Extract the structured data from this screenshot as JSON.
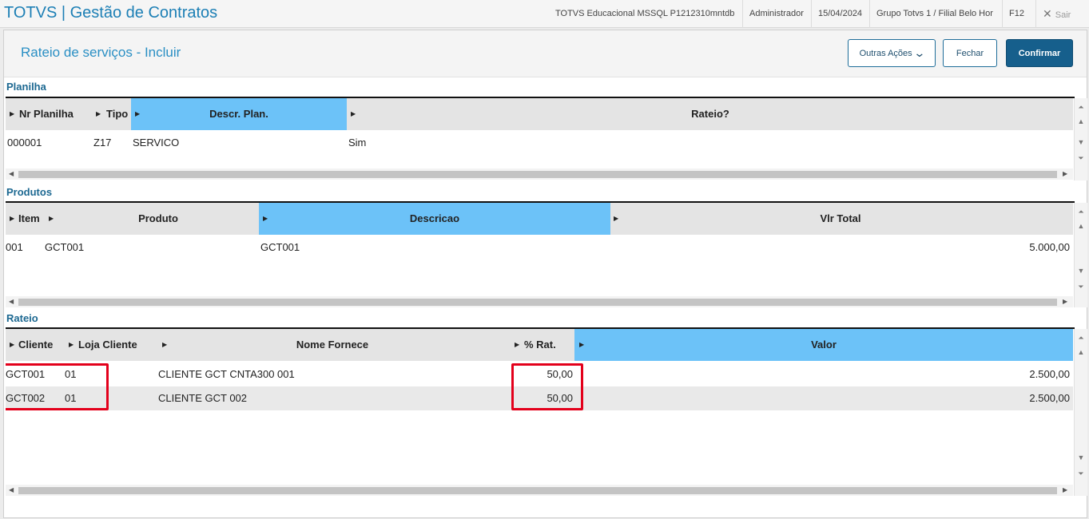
{
  "app": {
    "title": "TOTVS | Gestão de Contratos",
    "environment": "TOTVS Educacional MSSQL P1212310mntdb",
    "user": "Administrador",
    "date": "15/04/2024",
    "branch": "Grupo Totvs 1 / Filial Belo Hor",
    "help_key": "F12",
    "exit_label": "Sair"
  },
  "dialog": {
    "title": "Rateio de serviços - Incluir",
    "buttons": {
      "other_actions": "Outras Ações",
      "close": "Fechar",
      "confirm": "Confirmar"
    }
  },
  "planilha": {
    "title": "Planilha",
    "columns": [
      "Nr Planilha",
      "Tipo",
      "Descr. Plan.",
      "Rateio?"
    ],
    "rows": [
      {
        "nr": "000001",
        "tipo": "Z17",
        "descr": "SERVICO",
        "rateio": "Sim"
      }
    ]
  },
  "produtos": {
    "title": "Produtos",
    "columns": [
      "Item",
      "Produto",
      "Descricao",
      "Vlr Total"
    ],
    "rows": [
      {
        "item": "001",
        "produto": "GCT001",
        "descricao": "GCT001",
        "vlr_total": "5.000,00"
      }
    ]
  },
  "rateio": {
    "title": "Rateio",
    "columns": [
      "Cliente",
      "Loja Cliente",
      "Nome Fornece",
      "% Rat.",
      "Valor"
    ],
    "rows": [
      {
        "cliente": "GCT001",
        "loja": "01",
        "nome": "CLIENTE GCT CNTA300 001",
        "pct": "50,00",
        "valor": "2.500,00"
      },
      {
        "cliente": "GCT002",
        "loja": "01",
        "nome": "CLIENTE GCT 002",
        "pct": "50,00",
        "valor": "2.500,00"
      }
    ]
  },
  "colors": {
    "accent": "#1c7fb5",
    "selected_header": "#6cc2f8",
    "primary_button": "#165f8c",
    "highlight_box": "#e3001b"
  }
}
